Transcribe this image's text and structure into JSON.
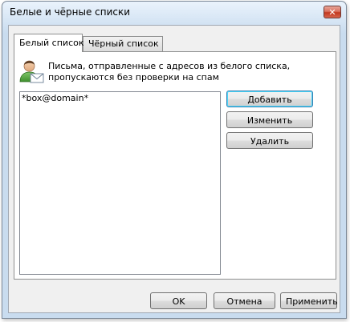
{
  "window": {
    "title": "Белые и чёрные списки",
    "close_glyph": "✕"
  },
  "tabs": [
    {
      "label": "Белый список",
      "active": true
    },
    {
      "label": "Чёрный список",
      "active": false
    }
  ],
  "info": {
    "icon": "user-mail-icon",
    "text": "Письма, отправленные с адресов из белого списка, пропускаются без проверки на спам"
  },
  "list": {
    "items": [
      "*box@domain*"
    ]
  },
  "side_buttons": {
    "add": "Добавить",
    "edit": "Изменить",
    "delete": "Удалить"
  },
  "footer_buttons": {
    "ok": "OK",
    "cancel": "Отмена",
    "apply": "Применить"
  },
  "colors": {
    "close_button": "#c2391f",
    "accent_focus": "#3c7fb1"
  }
}
